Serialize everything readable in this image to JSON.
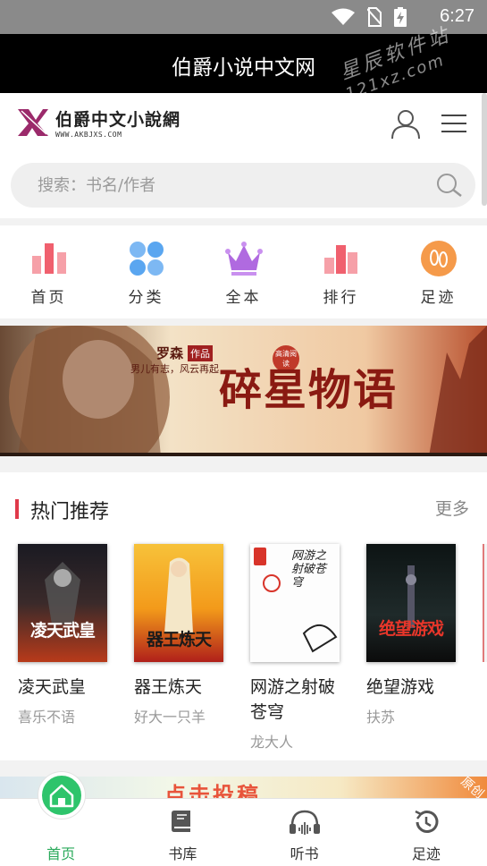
{
  "status_bar": {
    "time": "6:27"
  },
  "title_bar": {
    "title": "伯爵小说中文网",
    "watermark_top": "星辰软件站",
    "watermark_bottom": "121xz.com"
  },
  "header": {
    "logo_text": "伯爵中文小說網",
    "logo_url_text": "WWW.AKBJXS.COM"
  },
  "search": {
    "placeholder": "搜索：书名/作者"
  },
  "nav": {
    "items": [
      {
        "label": "首页",
        "icon": "bar-chart-icon",
        "color": "#f0606e"
      },
      {
        "label": "分类",
        "icon": "grid-icon",
        "color": "#5aa6f0"
      },
      {
        "label": "全本",
        "icon": "crown-icon",
        "color": "#b06ae0"
      },
      {
        "label": "排行",
        "icon": "ranking-icon",
        "color": "#f0606e"
      },
      {
        "label": "足迹",
        "icon": "footprint-icon",
        "color": "#f59a4a"
      }
    ]
  },
  "banner": {
    "author": "罗森",
    "tag": "作品",
    "badge": "高清阅读",
    "slogan": "男儿有志，风云再起",
    "book_title": "碎星物语"
  },
  "hot": {
    "heading": "热门推荐",
    "more": "更多",
    "books": [
      {
        "name": "凌天武皇",
        "author": "喜乐不语",
        "cover_text": "凌天武皇"
      },
      {
        "name": "器王炼天",
        "author": "好大一只羊",
        "cover_text": "器王炼天"
      },
      {
        "name": "网游之射破苍穹",
        "author": "龙大人",
        "cover_text": "网游之射破苍穹"
      },
      {
        "name": "绝望游戏",
        "author": "扶苏",
        "cover_text": "绝望游戏"
      }
    ]
  },
  "promo": {
    "text": "点击投稿",
    "corner": "原创"
  },
  "tabbar": {
    "items": [
      {
        "label": "首页",
        "icon": "home-icon",
        "active": true
      },
      {
        "label": "书库",
        "icon": "book-icon",
        "active": false
      },
      {
        "label": "听书",
        "icon": "headphones-icon",
        "active": false
      },
      {
        "label": "足迹",
        "icon": "history-icon",
        "active": false
      }
    ]
  },
  "colors": {
    "accent_green": "#2ec46b",
    "hot_bar": "#e0394a",
    "title_bg": "#000000"
  }
}
